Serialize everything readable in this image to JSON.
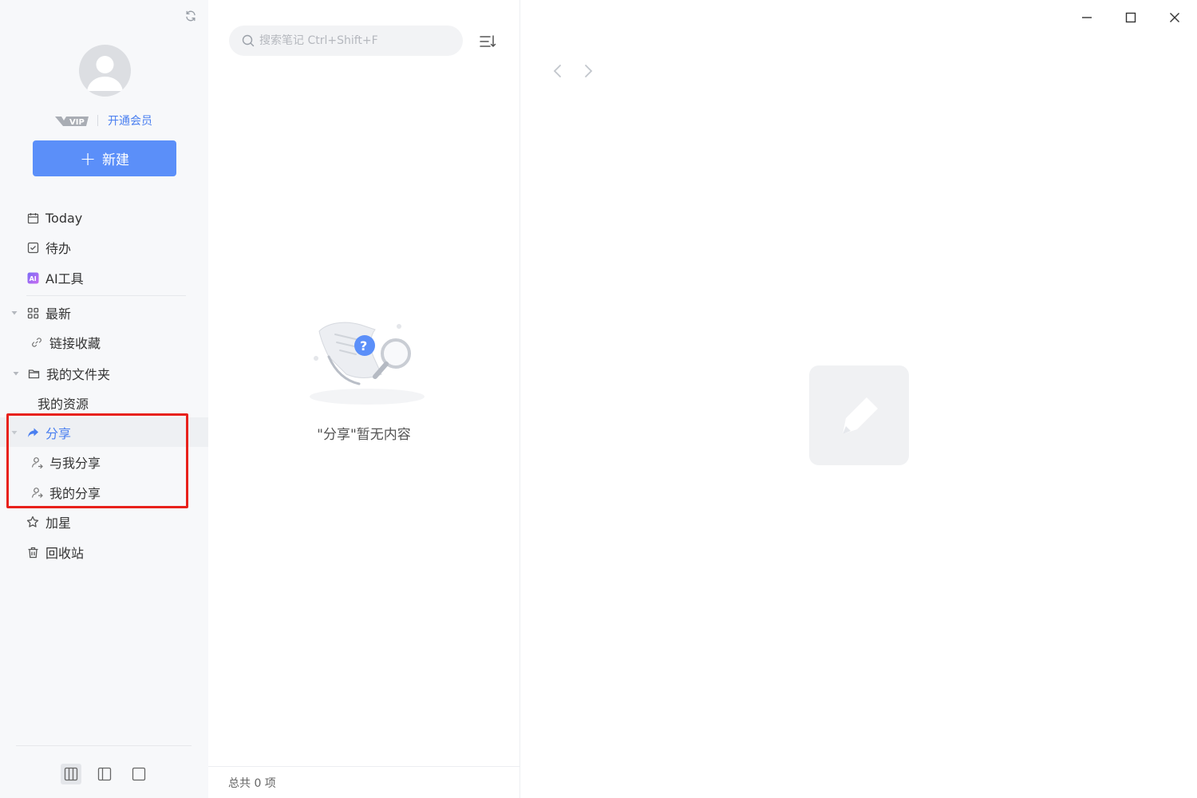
{
  "sidebar": {
    "vip_link": "开通会员",
    "new_button": "新建",
    "items": {
      "today": "Today",
      "todo": "待办",
      "ai_tools": "AI工具",
      "latest": "最新",
      "link_collection": "链接收藏",
      "my_folder": "我的文件夹",
      "my_resources": "我的资源",
      "share": "分享",
      "shared_with_me": "与我分享",
      "my_shares": "我的分享",
      "starred": "加星",
      "recycle_bin": "回收站"
    },
    "active_item": "share",
    "accent_color": "#5b8ff9",
    "highlight_color": "#e8211b"
  },
  "list": {
    "search_placeholder": "搜索笔记 Ctrl+Shift+F",
    "empty_message": "\"分享\"暂无内容",
    "footer": "总共 0 项"
  },
  "icons": {
    "sync": "sync-icon",
    "avatar": "user-avatar-icon",
    "vip": "vip-badge-icon",
    "today": "calendar-icon",
    "todo": "checkbox-icon",
    "ai": "ai-icon",
    "latest": "grid-icon",
    "link": "link-icon",
    "folder": "folder-icon",
    "share": "share-arrow-icon",
    "user": "user-icon",
    "star": "star-icon",
    "trash": "trash-icon",
    "sort": "sort-icon",
    "search": "search-icon"
  }
}
